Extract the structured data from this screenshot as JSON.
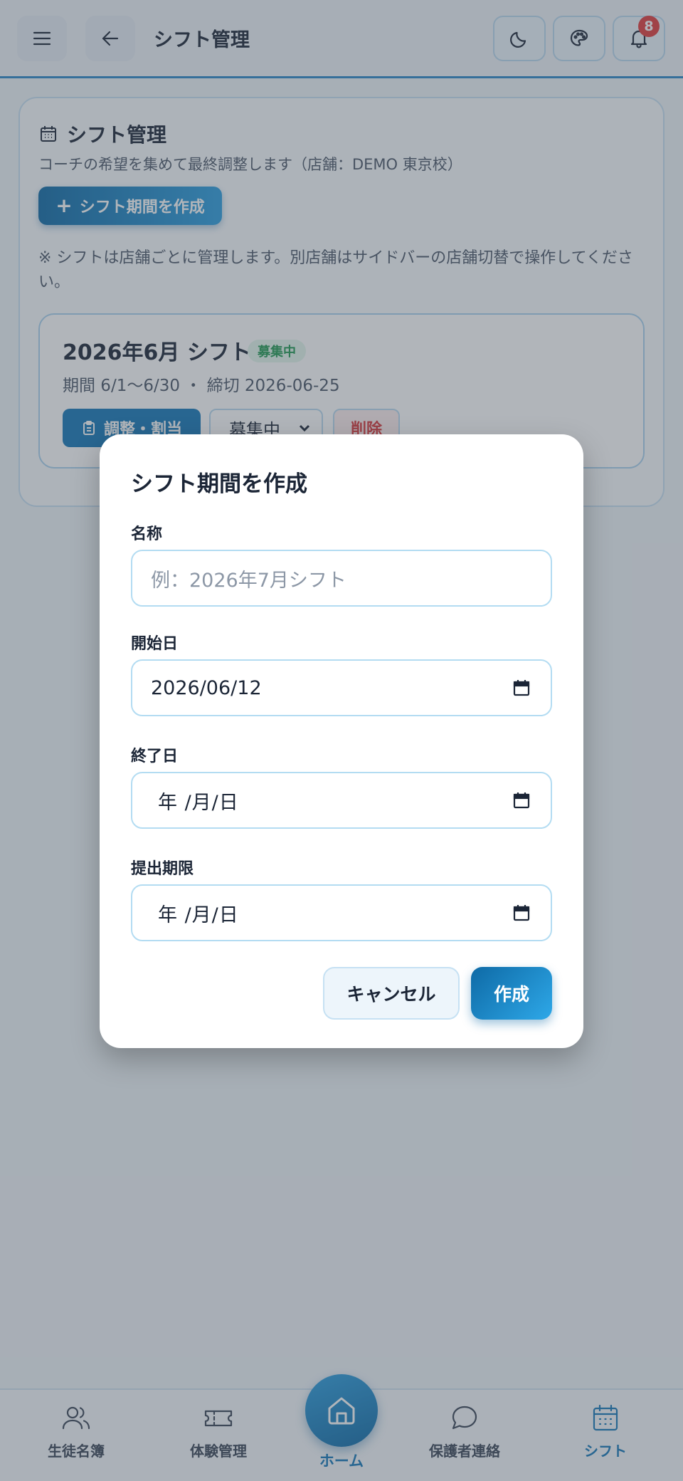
{
  "header": {
    "title": "シフト管理",
    "notification_count": "8"
  },
  "main": {
    "title": "シフト管理",
    "subtitle": "コーチの希望を集めて最終調整します（店舗：DEMO 東京校）",
    "create_button": "シフト期間を作成",
    "note": "※ シフトは店舗ごとに管理します。別店舗はサイドバーの店舗切替で操作してください。",
    "period": {
      "title": "2026年6月 シフト",
      "status_badge": "募集中",
      "meta": "期間 6/1〜6/30 ・ 締切 2026-06-25",
      "adjust_button": "調整・割当",
      "status_select": "募集中",
      "delete_button": "削除"
    }
  },
  "modal": {
    "title": "シフト期間を作成",
    "name_label": "名称",
    "name_placeholder": "例：2026年7月シフト",
    "start_label": "開始日",
    "start_value": "2026/06/12",
    "end_label": "終了日",
    "end_value": "年 /月/日",
    "deadline_label": "提出期限",
    "deadline_value": "年 /月/日",
    "cancel_button": "キャンセル",
    "submit_button": "作成"
  },
  "bottom_nav": {
    "items": [
      {
        "label": "生徒名簿",
        "icon": "users-icon"
      },
      {
        "label": "体験管理",
        "icon": "ticket-icon"
      },
      {
        "label": "ホーム",
        "icon": "home-icon"
      },
      {
        "label": "保護者連絡",
        "icon": "chat-icon"
      },
      {
        "label": "シフト",
        "icon": "calendar-icon"
      }
    ],
    "active": "シフト"
  },
  "colors": {
    "accent": "#1477b8",
    "accent_light": "#2c9fe0",
    "danger": "#d8363a",
    "success": "#1f9a52"
  }
}
